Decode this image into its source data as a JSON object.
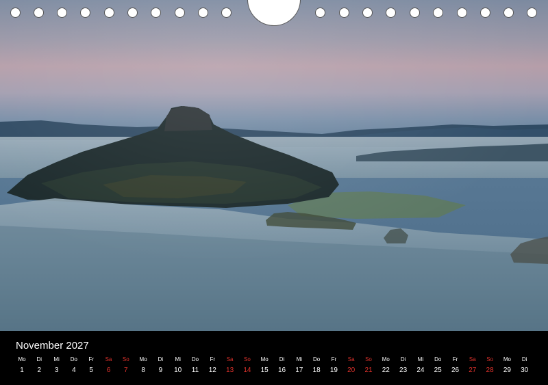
{
  "calendar": {
    "month_title": "November 2027",
    "accent_color": "#e0322c",
    "days": [
      {
        "dow": "Mo",
        "num": "1",
        "weekend": false
      },
      {
        "dow": "Di",
        "num": "2",
        "weekend": false
      },
      {
        "dow": "Mi",
        "num": "3",
        "weekend": false
      },
      {
        "dow": "Do",
        "num": "4",
        "weekend": false
      },
      {
        "dow": "Fr",
        "num": "5",
        "weekend": false
      },
      {
        "dow": "Sa",
        "num": "6",
        "weekend": true
      },
      {
        "dow": "So",
        "num": "7",
        "weekend": true
      },
      {
        "dow": "Mo",
        "num": "8",
        "weekend": false
      },
      {
        "dow": "Di",
        "num": "9",
        "weekend": false
      },
      {
        "dow": "Mi",
        "num": "10",
        "weekend": false
      },
      {
        "dow": "Do",
        "num": "11",
        "weekend": false
      },
      {
        "dow": "Fr",
        "num": "12",
        "weekend": false
      },
      {
        "dow": "Sa",
        "num": "13",
        "weekend": true
      },
      {
        "dow": "So",
        "num": "14",
        "weekend": true
      },
      {
        "dow": "Mo",
        "num": "15",
        "weekend": false
      },
      {
        "dow": "Di",
        "num": "16",
        "weekend": false
      },
      {
        "dow": "Mi",
        "num": "17",
        "weekend": false
      },
      {
        "dow": "Do",
        "num": "18",
        "weekend": false
      },
      {
        "dow": "Fr",
        "num": "19",
        "weekend": false
      },
      {
        "dow": "Sa",
        "num": "20",
        "weekend": true
      },
      {
        "dow": "So",
        "num": "21",
        "weekend": true
      },
      {
        "dow": "Mo",
        "num": "22",
        "weekend": false
      },
      {
        "dow": "Di",
        "num": "23",
        "weekend": false
      },
      {
        "dow": "Mi",
        "num": "24",
        "weekend": false
      },
      {
        "dow": "Do",
        "num": "25",
        "weekend": false
      },
      {
        "dow": "Fr",
        "num": "26",
        "weekend": false
      },
      {
        "dow": "Sa",
        "num": "27",
        "weekend": true
      },
      {
        "dow": "So",
        "num": "28",
        "weekend": true
      },
      {
        "dow": "Mo",
        "num": "29",
        "weekend": false
      },
      {
        "dow": "Di",
        "num": "30",
        "weekend": false
      }
    ]
  }
}
